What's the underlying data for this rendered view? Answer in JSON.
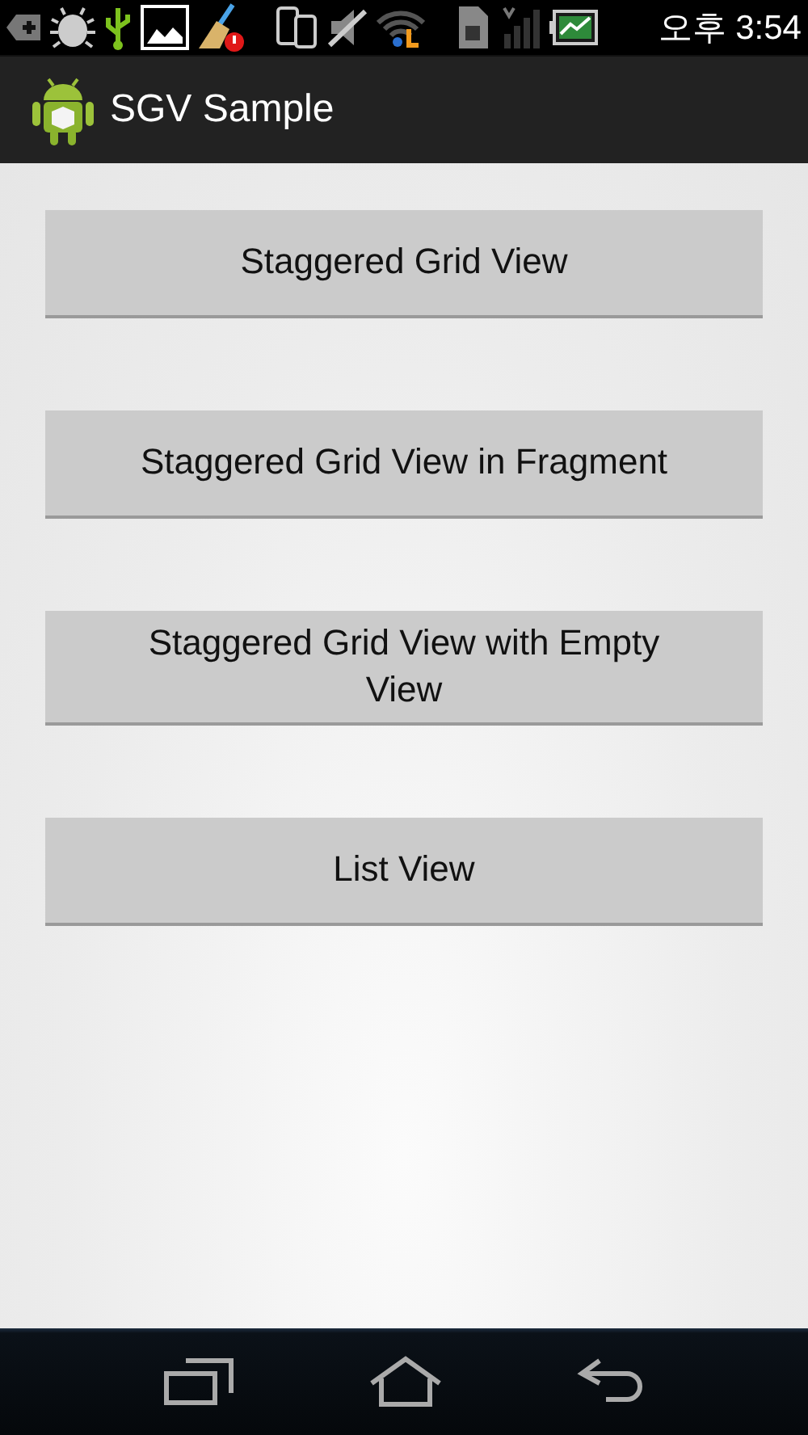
{
  "status_bar": {
    "time": "오후 3:54"
  },
  "action_bar": {
    "title": "SGV Sample"
  },
  "buttons": [
    {
      "label": "Staggered Grid View"
    },
    {
      "label": "Staggered Grid View in Fragment"
    },
    {
      "label": "Staggered Grid View with Empty View"
    },
    {
      "label": "List View"
    }
  ]
}
